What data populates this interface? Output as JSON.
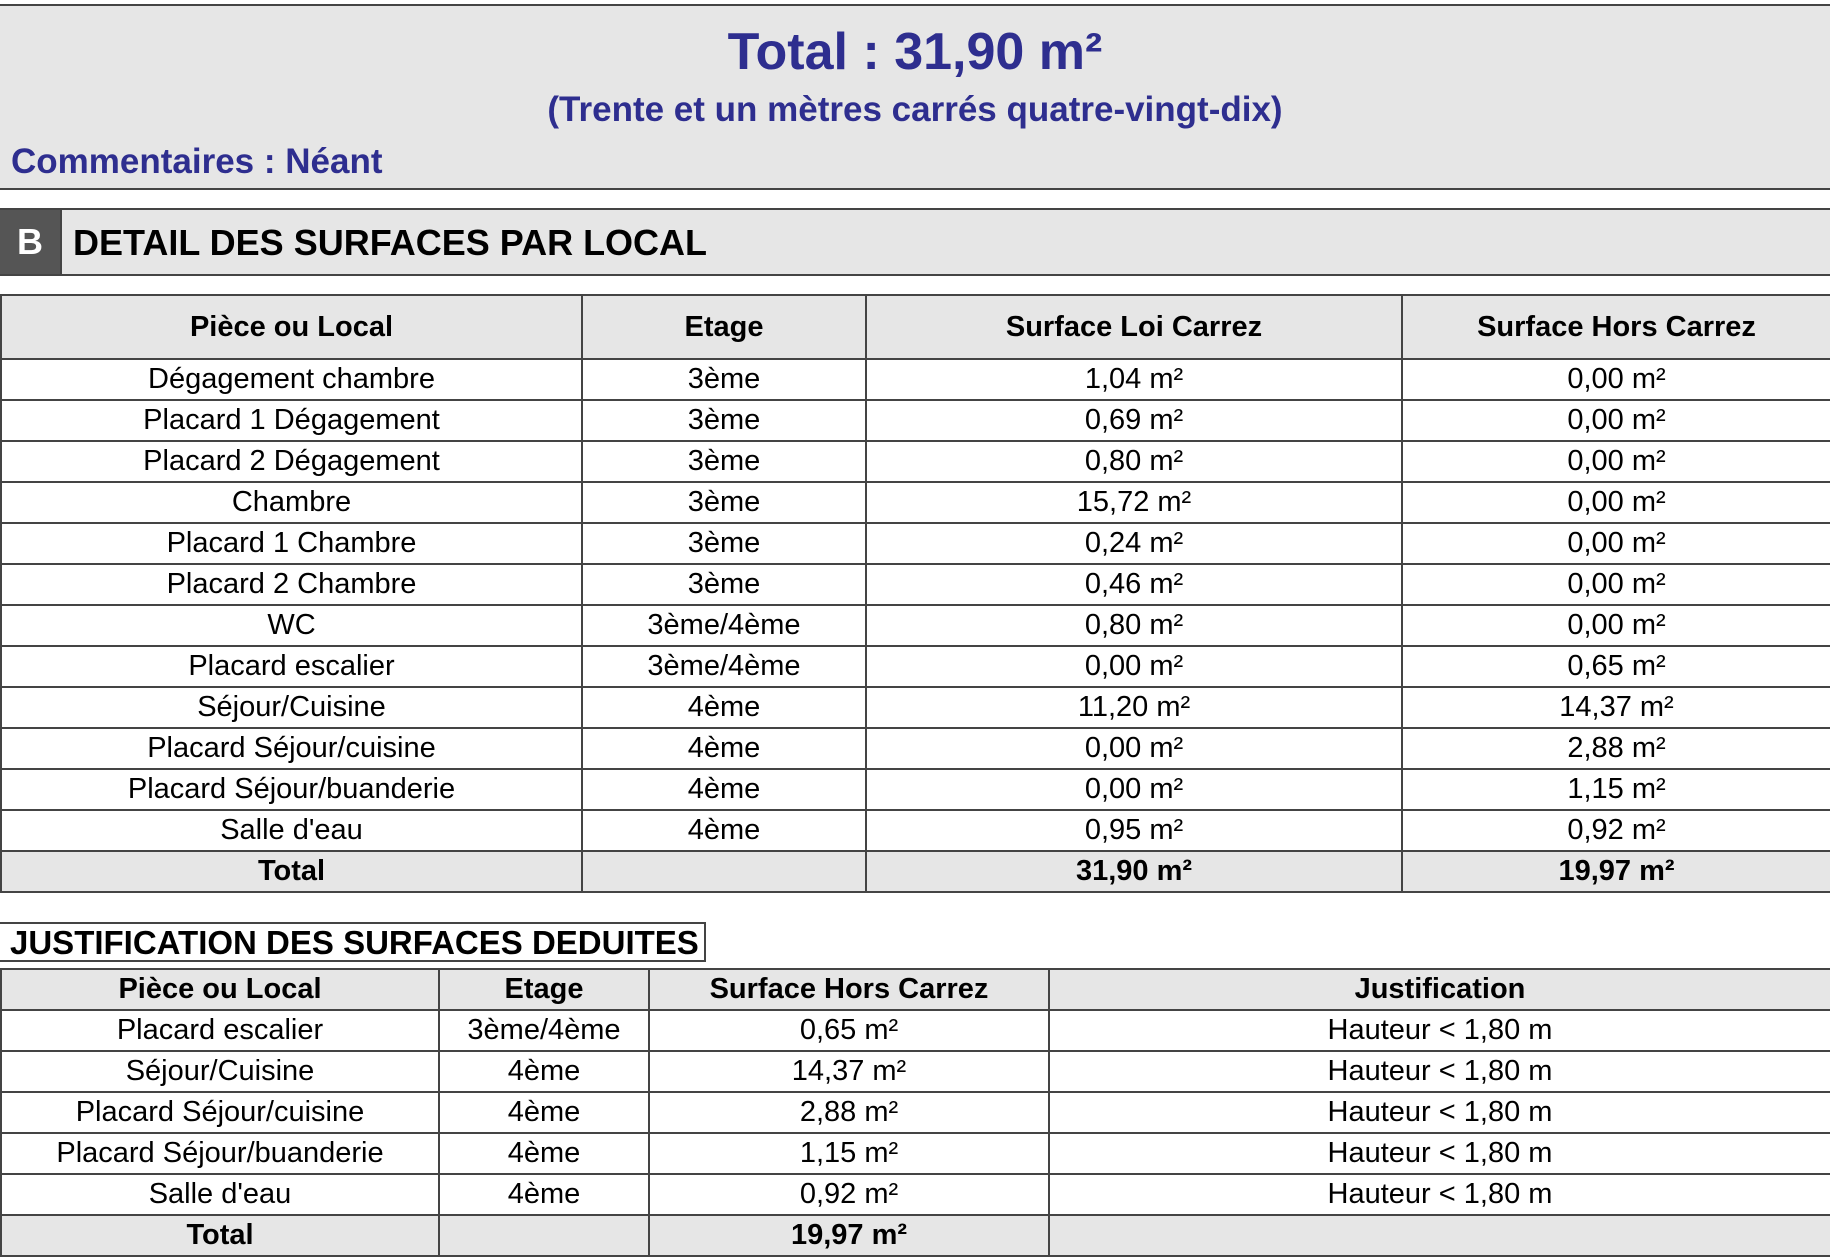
{
  "summary": {
    "total": "Total : 31,90 m²",
    "total_words": "(Trente et un mètres carrés quatre-vingt-dix)",
    "comments": "Commentaires : Néant"
  },
  "section": {
    "letter": "B",
    "title": "DETAIL DES SURFACES PAR LOCAL"
  },
  "detail_table": {
    "headers": [
      "Pièce ou Local",
      "Etage",
      "Surface Loi Carrez",
      "Surface Hors Carrez"
    ],
    "rows": [
      [
        "Dégagement chambre",
        "3ème",
        "1,04 m²",
        "0,00 m²"
      ],
      [
        "Placard 1 Dégagement",
        "3ème",
        "0,69 m²",
        "0,00 m²"
      ],
      [
        "Placard 2 Dégagement",
        "3ème",
        "0,80 m²",
        "0,00 m²"
      ],
      [
        "Chambre",
        "3ème",
        "15,72 m²",
        "0,00 m²"
      ],
      [
        "Placard 1 Chambre",
        "3ème",
        "0,24 m²",
        "0,00 m²"
      ],
      [
        "Placard 2 Chambre",
        "3ème",
        "0,46 m²",
        "0,00 m²"
      ],
      [
        "WC",
        "3ème/4ème",
        "0,80 m²",
        "0,00 m²"
      ],
      [
        "Placard escalier",
        "3ème/4ème",
        "0,00 m²",
        "0,65 m²"
      ],
      [
        "Séjour/Cuisine",
        "4ème",
        "11,20 m²",
        "14,37 m²"
      ],
      [
        "Placard Séjour/cuisine",
        "4ème",
        "0,00 m²",
        "2,88 m²"
      ],
      [
        "Placard Séjour/buanderie",
        "4ème",
        "0,00 m²",
        "1,15 m²"
      ],
      [
        "Salle d'eau",
        "4ème",
        "0,95 m²",
        "0,92 m²"
      ]
    ],
    "total": [
      "Total",
      "",
      "31,90 m²",
      "19,97 m²"
    ]
  },
  "justification": {
    "title": "JUSTIFICATION DES SURFACES DEDUITES",
    "headers": [
      "Pièce ou Local",
      "Etage",
      "Surface Hors Carrez",
      "Justification"
    ],
    "rows": [
      [
        "Placard escalier",
        "3ème/4ème",
        "0,65 m²",
        "Hauteur < 1,80 m"
      ],
      [
        "Séjour/Cuisine",
        "4ème",
        "14,37 m²",
        "Hauteur < 1,80 m"
      ],
      [
        "Placard Séjour/cuisine",
        "4ème",
        "2,88 m²",
        "Hauteur < 1,80 m"
      ],
      [
        "Placard Séjour/buanderie",
        "4ème",
        "1,15 m²",
        "Hauteur < 1,80 m"
      ],
      [
        "Salle d'eau",
        "4ème",
        "0,92 m²",
        "Hauteur < 1,80 m"
      ]
    ],
    "total": [
      "Total",
      "",
      "19,97 m²",
      ""
    ]
  },
  "colors": {
    "heading_blue": "#2e2e8f",
    "header_gray": "#e6e6e6",
    "badge_gray": "#555555"
  }
}
